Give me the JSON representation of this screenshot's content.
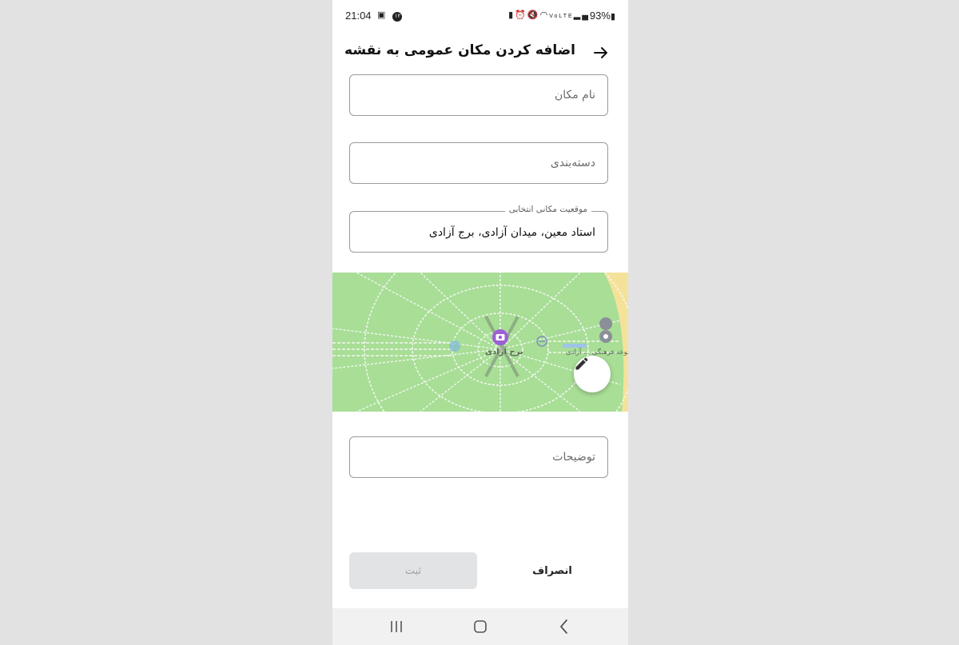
{
  "status_bar": {
    "time": "21:04",
    "notification_badge": "۱۲",
    "battery": "93%",
    "icons": [
      "gallery-icon",
      "notification-badge-icon",
      "battery-saver-icon",
      "alarm-icon",
      "mute-icon",
      "wifi-icon",
      "volte-icon",
      "signal-icon",
      "battery-icon"
    ]
  },
  "header": {
    "title": "اضافه کردن مکان عمومی به نقشه",
    "back_icon": "arrow-right-icon"
  },
  "form": {
    "place_name": {
      "placeholder": "نام مکان",
      "value": ""
    },
    "category": {
      "placeholder": "دسته‌بندی",
      "value": ""
    },
    "location": {
      "label": "موقعیت مکانی انتخابی",
      "value": "استاد معین، میدان آزادی، برج آزادی"
    },
    "description": {
      "placeholder": "توضیحات",
      "value": ""
    }
  },
  "map": {
    "primary_label": "برج آزادی",
    "secondary_label": "مجموعه فرهنگی ... آزادی",
    "pin_icon": "camera-pin-icon",
    "edit_icon": "pencil-icon",
    "colors": {
      "park": "#a8de96",
      "paths": "#f2f7ef",
      "road": "#f5e29a",
      "pin": "#9c5fd6"
    }
  },
  "actions": {
    "submit_label": "ثبت",
    "cancel_label": "انصراف"
  },
  "nav_bar": {
    "icons": [
      "recent-apps-icon",
      "home-icon",
      "back-icon"
    ]
  }
}
